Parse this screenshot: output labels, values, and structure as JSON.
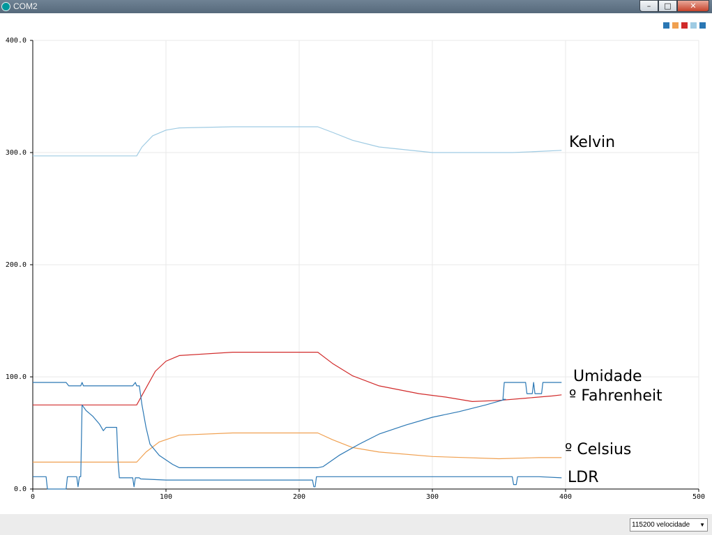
{
  "window": {
    "title": "COM2",
    "minimize_glyph": "–",
    "maximize_glyph": "□",
    "close_glyph": "✕"
  },
  "baud_select": {
    "value": "115200 velocidade",
    "arrow_glyph": "▼"
  },
  "legend_colors": [
    "#2a77b4",
    "#f0a050",
    "#d12a2a",
    "#9fcbe3",
    "#2a77b4"
  ],
  "annotations": {
    "kelvin": "Kelvin",
    "umidade": "Umidade",
    "fahrenheit": "º Fahrenheit",
    "celsius": "º Celsius",
    "ldr": "LDR"
  },
  "chart_data": {
    "type": "line",
    "xlim": [
      0,
      500
    ],
    "ylim": [
      0,
      400
    ],
    "x_ticks": [
      "0",
      "100",
      "200",
      "300",
      "400",
      "500"
    ],
    "y_ticks": [
      "0.0",
      "100.0",
      "200.0",
      "300.0",
      "400.0"
    ],
    "grid": true,
    "legend_placement": "top-right",
    "series": [
      {
        "color": "#9fcbe3",
        "points": [
          [
            0,
            297
          ],
          [
            78,
            297
          ],
          [
            82,
            305
          ],
          [
            90,
            315
          ],
          [
            100,
            320
          ],
          [
            110,
            322
          ],
          [
            150,
            323
          ],
          [
            214,
            323
          ],
          [
            225,
            318
          ],
          [
            240,
            311
          ],
          [
            260,
            305
          ],
          [
            300,
            300
          ],
          [
            360,
            300
          ],
          [
            380,
            301
          ],
          [
            397,
            302
          ]
        ]
      },
      {
        "color": "#d12a2a",
        "points": [
          [
            0,
            75
          ],
          [
            78,
            75
          ],
          [
            85,
            90
          ],
          [
            92,
            105
          ],
          [
            100,
            114
          ],
          [
            110,
            119
          ],
          [
            150,
            122
          ],
          [
            214,
            122
          ],
          [
            225,
            112
          ],
          [
            240,
            101
          ],
          [
            260,
            92
          ],
          [
            290,
            85
          ],
          [
            310,
            82
          ],
          [
            330,
            78
          ],
          [
            350,
            79
          ],
          [
            370,
            81
          ],
          [
            390,
            83
          ],
          [
            397,
            84
          ]
        ]
      },
      {
        "color": "#f0a050",
        "points": [
          [
            0,
            24
          ],
          [
            78,
            24
          ],
          [
            85,
            33
          ],
          [
            95,
            42
          ],
          [
            110,
            48
          ],
          [
            150,
            50
          ],
          [
            214,
            50
          ],
          [
            225,
            44
          ],
          [
            240,
            37
          ],
          [
            260,
            33
          ],
          [
            300,
            29
          ],
          [
            350,
            27
          ],
          [
            380,
            28
          ],
          [
            397,
            28
          ]
        ]
      },
      {
        "color": "#2a77b4",
        "points": [
          [
            0,
            95
          ],
          [
            25,
            95
          ],
          [
            27,
            92
          ],
          [
            36,
            92
          ],
          [
            37,
            95
          ],
          [
            38,
            92
          ],
          [
            75,
            92
          ],
          [
            77,
            95
          ],
          [
            78,
            92
          ],
          [
            80,
            92
          ],
          [
            82,
            75
          ],
          [
            85,
            55
          ],
          [
            88,
            40
          ],
          [
            95,
            30
          ],
          [
            105,
            22
          ],
          [
            110,
            19
          ],
          [
            150,
            19
          ],
          [
            214,
            19
          ],
          [
            218,
            20
          ],
          [
            230,
            30
          ],
          [
            245,
            40
          ],
          [
            260,
            49
          ],
          [
            280,
            57
          ],
          [
            300,
            64
          ],
          [
            320,
            69
          ],
          [
            340,
            75
          ],
          [
            355,
            80
          ],
          [
            353,
            80
          ],
          [
            354,
            95
          ],
          [
            370,
            95
          ],
          [
            371,
            85
          ],
          [
            375,
            85
          ],
          [
            376,
            95
          ],
          [
            377,
            85
          ],
          [
            382,
            85
          ],
          [
            383,
            95
          ],
          [
            397,
            95
          ]
        ]
      },
      {
        "color": "#2a77b4",
        "points": [
          [
            0,
            11
          ],
          [
            10,
            11
          ],
          [
            11,
            0
          ],
          [
            25,
            0
          ],
          [
            26,
            11
          ],
          [
            33,
            11
          ],
          [
            34,
            2
          ],
          [
            35,
            11
          ],
          [
            36,
            11
          ],
          [
            37,
            75
          ],
          [
            40,
            70
          ],
          [
            45,
            65
          ],
          [
            50,
            58
          ],
          [
            53,
            52
          ],
          [
            55,
            55
          ],
          [
            58,
            55
          ],
          [
            63,
            55
          ],
          [
            64,
            25
          ],
          [
            65,
            10
          ],
          [
            75,
            10
          ],
          [
            76,
            2
          ],
          [
            77,
            10
          ],
          [
            80,
            10
          ],
          [
            81,
            9
          ],
          [
            100,
            8
          ],
          [
            150,
            8
          ],
          [
            210,
            8
          ],
          [
            211,
            2
          ],
          [
            212,
            2
          ],
          [
            213,
            11
          ],
          [
            250,
            11
          ],
          [
            300,
            11
          ],
          [
            360,
            11
          ],
          [
            361,
            4
          ],
          [
            363,
            4
          ],
          [
            364,
            11
          ],
          [
            380,
            11
          ],
          [
            397,
            10
          ]
        ]
      }
    ]
  }
}
